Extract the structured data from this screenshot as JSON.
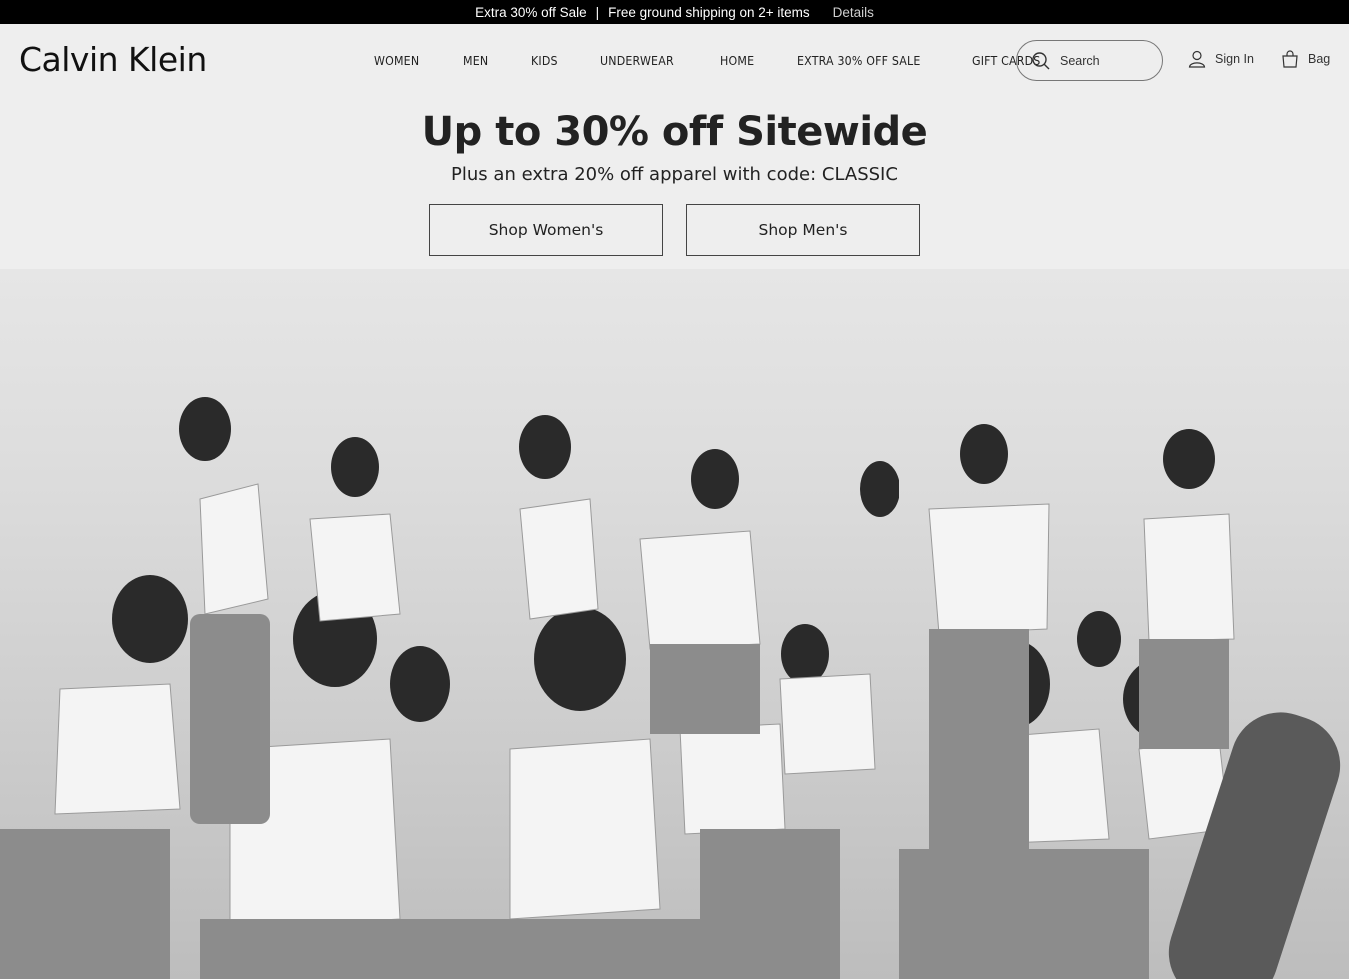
{
  "promo": {
    "part1": "Extra 30% off Sale",
    "separator": "|",
    "part2": "Free ground shipping on 2+ items",
    "details": "Details"
  },
  "header": {
    "logo": "Calvin Klein",
    "nav": [
      "WOMEN",
      "MEN",
      "KIDS",
      "UNDERWEAR",
      "HOME",
      "EXTRA 30% OFF SALE",
      "GIFT CARDS"
    ],
    "search_placeholder": "Search",
    "signin": "Sign In",
    "bag": "Bag"
  },
  "hero": {
    "headline": "Up to 30% off Sitewide",
    "subhead": "Plus an extra 20% off apparel with code: CLASSIC",
    "btn_women": "Shop Women's",
    "btn_men": "Shop Men's"
  },
  "colors": {
    "promo_bg": "#000000",
    "page_bg": "#eeeeee",
    "text": "#222222"
  }
}
